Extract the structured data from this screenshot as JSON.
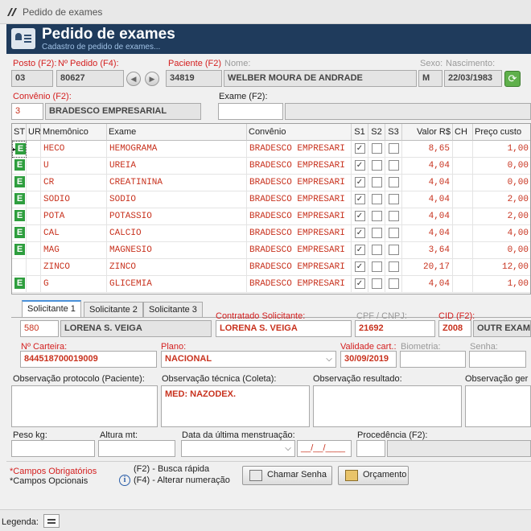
{
  "window": {
    "title": "Pedido de exames"
  },
  "header": {
    "title": "Pedido de exames",
    "subtitle": "Cadastro de pedido de exames..."
  },
  "labels": {
    "posto": "Posto (F2):",
    "npedido": "Nº Pedido (F4):",
    "paciente": "Paciente (F2)",
    "nome": "Nome:",
    "sexo": "Sexo:",
    "nascimento": "Nascimento:",
    "convenio": "Convênio (F2):",
    "exame": "Exame (F2):"
  },
  "fields": {
    "posto": "03",
    "npedido": "80627",
    "paciente_codigo": "34819",
    "nome": "WELBER MOURA DE ANDRADE",
    "sexo": "M",
    "nascimento": "22/03/1983",
    "convenio_codigo": "3",
    "convenio_nome": "BRADESCO EMPRESARIAL",
    "exame": ""
  },
  "grid": {
    "columns": [
      "ST",
      "UR",
      "Mnemônico",
      "Exame",
      "Convênio",
      "S1",
      "S2",
      "S3",
      "Valor R$",
      "CH",
      "Preço custo"
    ],
    "rows": [
      {
        "st": "E",
        "mnem": "HECO",
        "exame": "HEMOGRAMA",
        "conv": "BRADESCO EMPRESARI",
        "s1": true,
        "s2": false,
        "s3": false,
        "valor": "8,65",
        "ch": "",
        "custo": "1,00",
        "current": true
      },
      {
        "st": "E",
        "mnem": "U",
        "exame": "UREIA",
        "conv": "BRADESCO EMPRESARI",
        "s1": true,
        "s2": false,
        "s3": false,
        "valor": "4,04",
        "ch": "",
        "custo": "0,00",
        "current": false
      },
      {
        "st": "E",
        "mnem": "CR",
        "exame": "CREATININA",
        "conv": "BRADESCO EMPRESARI",
        "s1": true,
        "s2": false,
        "s3": false,
        "valor": "4,04",
        "ch": "",
        "custo": "0,00",
        "current": false
      },
      {
        "st": "E",
        "mnem": "SODIO",
        "exame": "SODIO",
        "conv": "BRADESCO EMPRESARI",
        "s1": true,
        "s2": false,
        "s3": false,
        "valor": "4,04",
        "ch": "",
        "custo": "2,00",
        "current": false
      },
      {
        "st": "E",
        "mnem": "POTA",
        "exame": "POTASSIO",
        "conv": "BRADESCO EMPRESARI",
        "s1": true,
        "s2": false,
        "s3": false,
        "valor": "4,04",
        "ch": "",
        "custo": "2,00",
        "current": false
      },
      {
        "st": "E",
        "mnem": "CAL",
        "exame": "CALCIO",
        "conv": "BRADESCO EMPRESARI",
        "s1": true,
        "s2": false,
        "s3": false,
        "valor": "4,04",
        "ch": "",
        "custo": "4,00",
        "current": false
      },
      {
        "st": "E",
        "mnem": "MAG",
        "exame": "MAGNESIO",
        "conv": "BRADESCO EMPRESARI",
        "s1": true,
        "s2": false,
        "s3": false,
        "valor": "3,64",
        "ch": "",
        "custo": "0,00",
        "current": false
      },
      {
        "st": "",
        "mnem": "ZINCO",
        "exame": "ZINCO",
        "conv": "BRADESCO EMPRESARI",
        "s1": true,
        "s2": false,
        "s3": false,
        "valor": "20,17",
        "ch": "",
        "custo": "12,00",
        "current": false
      },
      {
        "st": "E",
        "mnem": "G",
        "exame": "GLICEMIA",
        "conv": "BRADESCO EMPRESARI",
        "s1": true,
        "s2": false,
        "s3": false,
        "valor": "4,04",
        "ch": "",
        "custo": "1,00",
        "current": false
      }
    ]
  },
  "tabs": [
    "Solicitante 1",
    "Solicitante 2",
    "Solicitante 3"
  ],
  "solicitante": {
    "codigo": "580",
    "nome": "LORENA S. VEIGA",
    "contratado_label": "Contratado Solicitante:",
    "contratado": "LORENA S. VEIGA",
    "cpf_label": "CPF / CNPJ:",
    "cpf": "21692",
    "cid_label": "CID  (F2):",
    "cid": "Z008",
    "cid_desc": "OUTR EXAMI"
  },
  "carteira": {
    "carteira_label": "Nº Carteira:",
    "carteira": "844518700019009",
    "plano_label": "Plano:",
    "plano": "NACIONAL",
    "validade_label": "Validade cart.:",
    "validade": "30/09/2019",
    "biometria_label": "Biometria:",
    "senha_label": "Senha:"
  },
  "observacoes": {
    "protocolo_label": "Observação protocolo (Paciente):",
    "tecnica_label": "Observação técnica (Coleta):",
    "tecnica": "MED: NAZODEX.",
    "resultado_label": "Observação resultado:",
    "geral_label": "Observação ger"
  },
  "medidas": {
    "peso_label": "Peso kg:",
    "altura_label": "Altura mt:",
    "menstruacao_label": "Data da última menstruação:",
    "menstruacao_placeholder": "__/__/____",
    "procedencia_label": "Procedência (F2):"
  },
  "footer": {
    "obrigatorios": "*Campos Obrigatórios",
    "opcionais": "*Campos Opcionais",
    "hint1": "(F2) - Busca rápida",
    "hint2": "(F4) - Alterar numeração",
    "chamar_senha": "Chamar Senha",
    "orcamento": "Orçamento"
  },
  "legend": {
    "label": "Legenda:"
  }
}
